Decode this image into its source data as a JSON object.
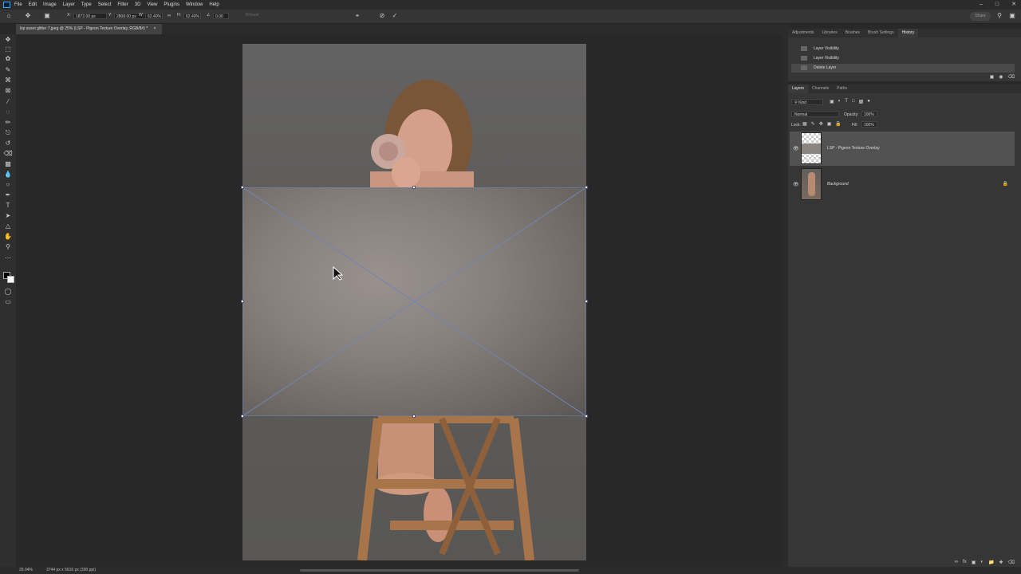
{
  "menubar": {
    "app_icon": "photoshop-icon",
    "items": [
      "File",
      "Edit",
      "Image",
      "Layer",
      "Type",
      "Select",
      "Filter",
      "3D",
      "View",
      "Plugins",
      "Window",
      "Help"
    ],
    "window_controls": [
      "–",
      "□",
      "✕"
    ]
  },
  "options": {
    "x_label": "X:",
    "x_value": "1872.00 px",
    "y_label": "Y:",
    "y_value": "2808.00 px",
    "w_label": "W:",
    "w_value": "62.40%",
    "h_label": "H:",
    "h_value": "62.40%",
    "angle_label": "∠",
    "angle_value": "0.00",
    "interp": "Bilinear",
    "cancel_icon": "⊘",
    "commit_icon": "✓",
    "share_label": "Share"
  },
  "document": {
    "tab_title": "lsp asset glitter 7.jpeg @ 25% (LSP - Pigeon Texture Overlay, RGB/8#) *",
    "close": "×"
  },
  "history": {
    "tabs": [
      "Adjustments",
      "Libraries",
      "Brushes",
      "Brush Settings",
      "History"
    ],
    "active_tab": "History",
    "items": [
      {
        "label": "Layer Visibility"
      },
      {
        "label": "Layer Visibility"
      },
      {
        "label": "Delete Layer",
        "active": true
      }
    ]
  },
  "layers": {
    "tabs": [
      "Layers",
      "Channels",
      "Paths"
    ],
    "active_tab": "Layers",
    "filter_label": "Kind",
    "blend_mode": "Normal",
    "opacity_label": "Opacity:",
    "opacity_value": "100%",
    "lock_label": "Lock:",
    "fill_label": "Fill:",
    "fill_value": "100%",
    "items": [
      {
        "name": "LSP - Pigeon Texture Overlay",
        "visible": true,
        "selected": true
      },
      {
        "name": "Background",
        "visible": true,
        "locked": true
      }
    ]
  },
  "status": {
    "zoom": "25.04%",
    "doc_size": "3744 px x 5616 px (300 ppi)"
  }
}
